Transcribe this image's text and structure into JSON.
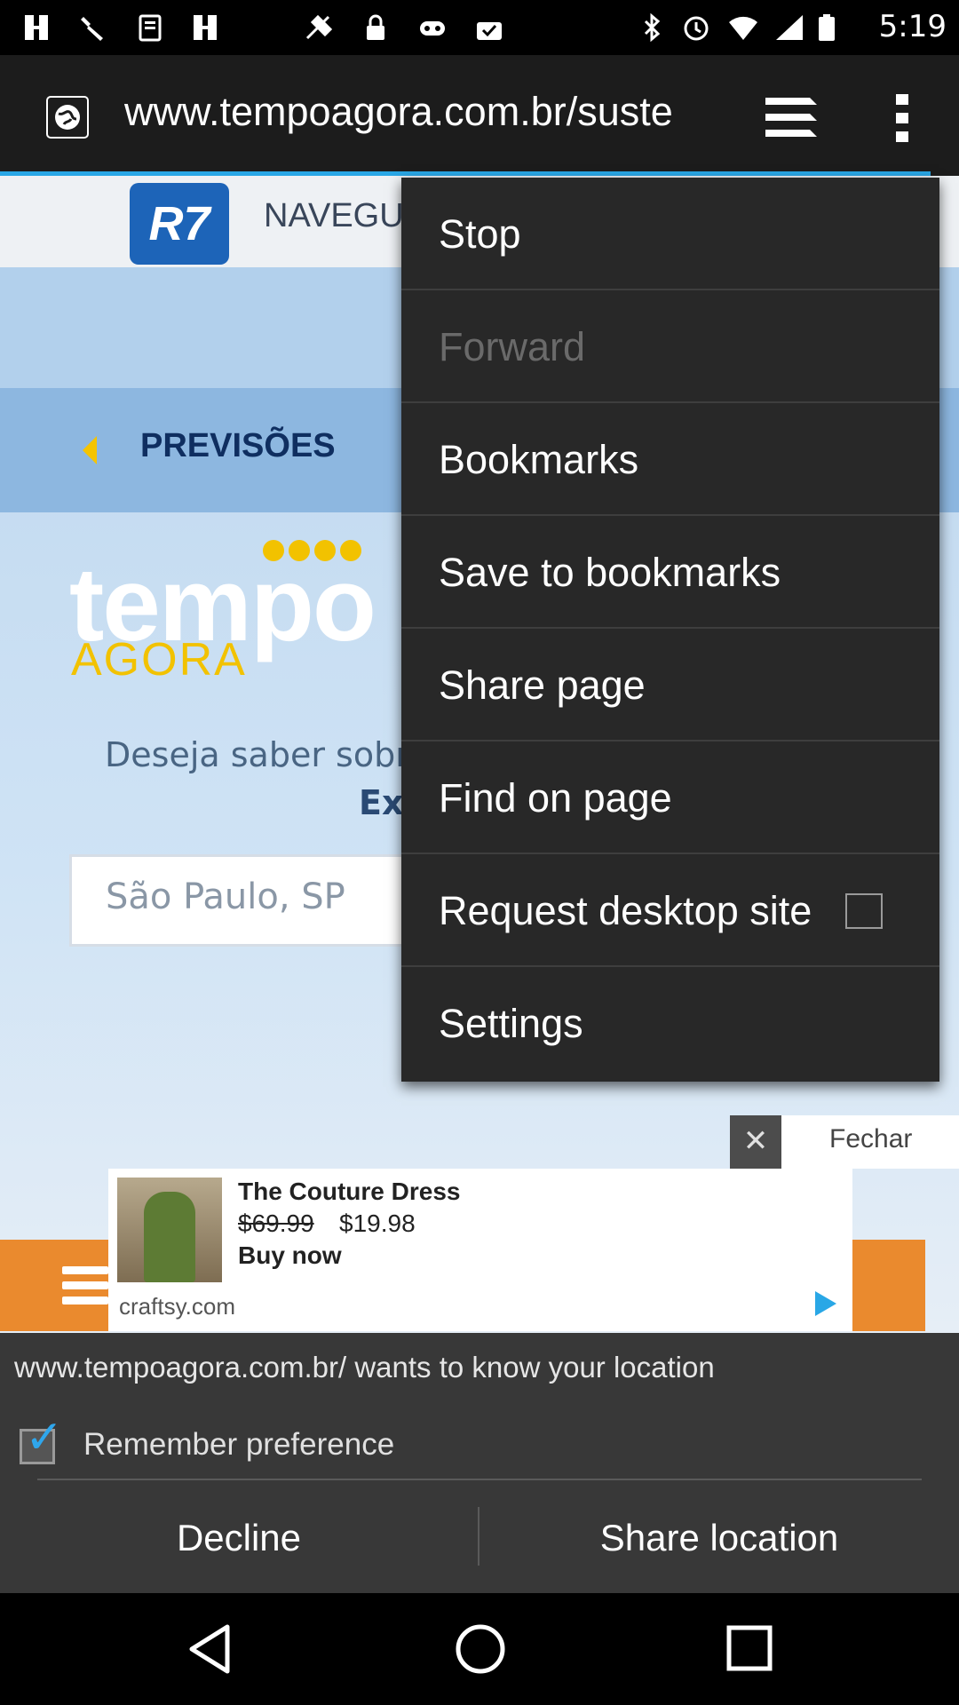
{
  "status_bar": {
    "time": "5:19",
    "left_icons": [
      "notification-icon",
      "wrench-icon",
      "clipboard-icon",
      "notification-icon",
      "gps-fake-icon",
      "lock-icon",
      "gamepad-icon",
      "download-check-icon"
    ],
    "right_icons": [
      "bluetooth-icon",
      "alarm-icon",
      "wifi-icon",
      "signal-icon",
      "battery-icon"
    ]
  },
  "address_bar": {
    "url": "www.tempoagora.com.br/suste",
    "site_icon": "globe-icon",
    "tabs_icon": "tabs-icon",
    "menu_icon": "overflow-menu-icon",
    "progress_fraction": 0.97
  },
  "page": {
    "r7_logo": "R7",
    "r7_nav": "NAVEGU",
    "previsoes": "PREVISÕES",
    "logo_tempo": "tempo",
    "logo_agora": "AGORA",
    "deseja": "Deseja saber sobr",
    "ex": "Ex",
    "city_input": "São Paulo, SP",
    "close_label": "Fechar"
  },
  "ad": {
    "title": "The Couture Dress",
    "price_old": "$69.99",
    "price_new": "$19.98",
    "cta": "Buy now",
    "domain": "craftsy.com"
  },
  "permission": {
    "message": "www.tempoagora.com.br/ wants to know your location",
    "remember_label": "Remember preference",
    "remember_checked": true,
    "decline": "Decline",
    "share": "Share location"
  },
  "menu": {
    "items": [
      {
        "label": "Stop",
        "enabled": true
      },
      {
        "label": "Forward",
        "enabled": false
      },
      {
        "label": "Bookmarks",
        "enabled": true
      },
      {
        "label": "Save to bookmarks",
        "enabled": true
      },
      {
        "label": "Share page",
        "enabled": true
      },
      {
        "label": "Find on page",
        "enabled": true
      },
      {
        "label": "Request desktop site",
        "enabled": true,
        "checked": false
      },
      {
        "label": "Settings",
        "enabled": true
      }
    ]
  },
  "nav_bar": {
    "buttons": [
      "back-icon",
      "home-icon",
      "recents-icon"
    ]
  },
  "colors": {
    "accent": "#29a7e6",
    "menu_bg": "#282828",
    "permission_bg": "#383838",
    "ad_orange": "#ea8a2e"
  }
}
